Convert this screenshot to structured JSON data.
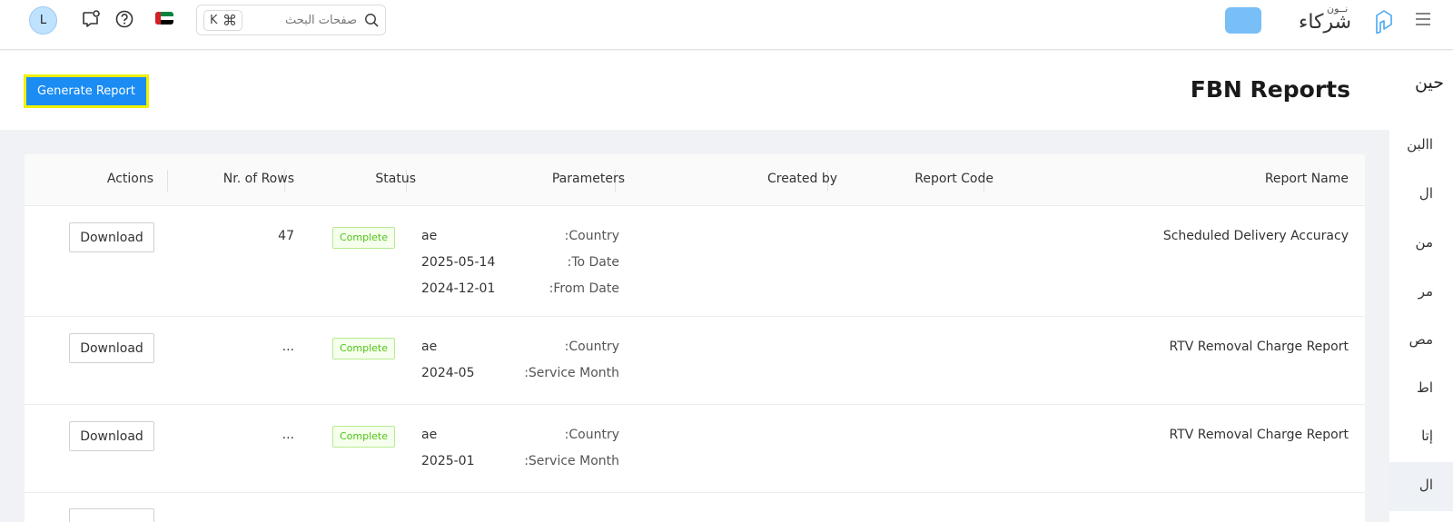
{
  "header": {
    "avatar_initial": "L",
    "search_placeholder": "صفحات البحث",
    "kbd_key": "K",
    "kbd_mod": "⌘",
    "logo_small": "نــون",
    "logo_main": "شركاء",
    "brand_color": "#79bff7",
    "icons": [
      "feedback-icon",
      "help-icon",
      "uae-flag-icon",
      "search-icon",
      "menu-icon"
    ]
  },
  "page": {
    "title": "FBN Reports",
    "generate_label": "Generate Report"
  },
  "sidebar": {
    "heading": "حين",
    "items": [
      {
        "label": "االبن",
        "active": false
      },
      {
        "label": "ال",
        "active": false
      },
      {
        "label": "من",
        "active": false
      },
      {
        "label": "مر",
        "active": false
      },
      {
        "label": "مص",
        "active": false
      },
      {
        "label": "اط",
        "active": false
      },
      {
        "label": "إتا",
        "active": false
      },
      {
        "label": "ال",
        "active": true
      }
    ]
  },
  "table": {
    "columns": [
      "Report Name",
      "Report Code",
      "Created by",
      "Parameters",
      "Status",
      "Nr. of Rows",
      "Actions"
    ],
    "rows": [
      {
        "name": "Scheduled Delivery Accuracy",
        "code": "",
        "created_by": "",
        "params": [
          {
            "label": ":Country",
            "value": "ae"
          },
          {
            "label": ":To Date",
            "value": "2025-05-14"
          },
          {
            "label": ":From Date",
            "value": "2024-12-01"
          }
        ],
        "status": "Complete",
        "rows": "47",
        "action": "Download"
      },
      {
        "name": "RTV Removal Charge Report",
        "code": "",
        "created_by": "",
        "params": [
          {
            "label": ":Country",
            "value": "ae"
          },
          {
            "label": ":Service Month",
            "value": "2024-05"
          }
        ],
        "status": "Complete",
        "rows": "...",
        "action": "Download"
      },
      {
        "name": "RTV Removal Charge Report",
        "code": "",
        "created_by": "",
        "params": [
          {
            "label": ":Country",
            "value": "ae"
          },
          {
            "label": ":Service Month",
            "value": "2025-01"
          }
        ],
        "status": "Complete",
        "rows": "...",
        "action": "Download"
      }
    ],
    "status_color": "#52c41a"
  },
  "colors": {
    "primary": "#1b8cf4",
    "highlight_border": "#f0f000",
    "avatar_bg": "#bfe2ff"
  }
}
